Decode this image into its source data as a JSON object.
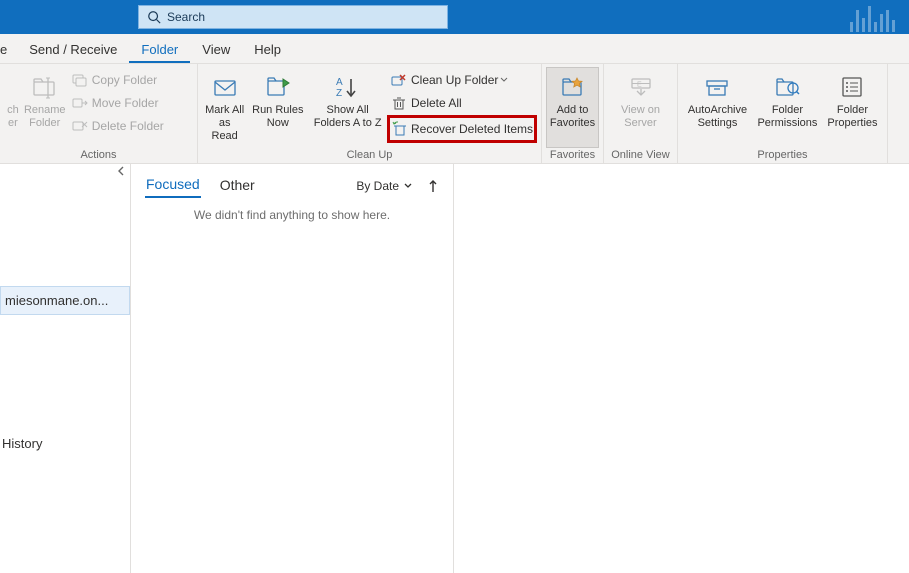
{
  "search": {
    "placeholder": "Search"
  },
  "tabs": {
    "items": [
      "e",
      "Send / Receive",
      "Folder",
      "View",
      "Help"
    ],
    "activeIndex": 2
  },
  "ribbon": {
    "groups": {
      "actions": {
        "label": "Actions",
        "search_cut_line1": "ch",
        "search_cut_line2": "er",
        "rename_line1": "Rename",
        "rename_line2": "Folder",
        "copy": "Copy Folder",
        "move": "Move Folder",
        "delete": "Delete Folder"
      },
      "cleanup": {
        "label": "Clean Up",
        "markall_line1": "Mark All",
        "markall_line2": "as Read",
        "runrules_line1": "Run Rules",
        "runrules_line2": "Now",
        "showall_line1": "Show All",
        "showall_line2": "Folders A to Z",
        "cleanup_folder": "Clean Up Folder",
        "delete_all": "Delete All",
        "recover": "Recover Deleted Items"
      },
      "favorites": {
        "label": "Favorites",
        "add_line1": "Add to",
        "add_line2": "Favorites"
      },
      "onlineview": {
        "label": "Online View",
        "view_line1": "View on",
        "view_line2": "Server"
      },
      "properties": {
        "label": "Properties",
        "auto_line1": "AutoArchive",
        "auto_line2": "Settings",
        "perm_line1": "Folder",
        "perm_line2": "Permissions",
        "prop_line1": "Folder",
        "prop_line2": "Properties"
      }
    }
  },
  "nav": {
    "account": "miesonmane.on...",
    "history": "History"
  },
  "list": {
    "focused": "Focused",
    "other": "Other",
    "sort": "By Date",
    "empty": "We didn't find anything to show here."
  }
}
